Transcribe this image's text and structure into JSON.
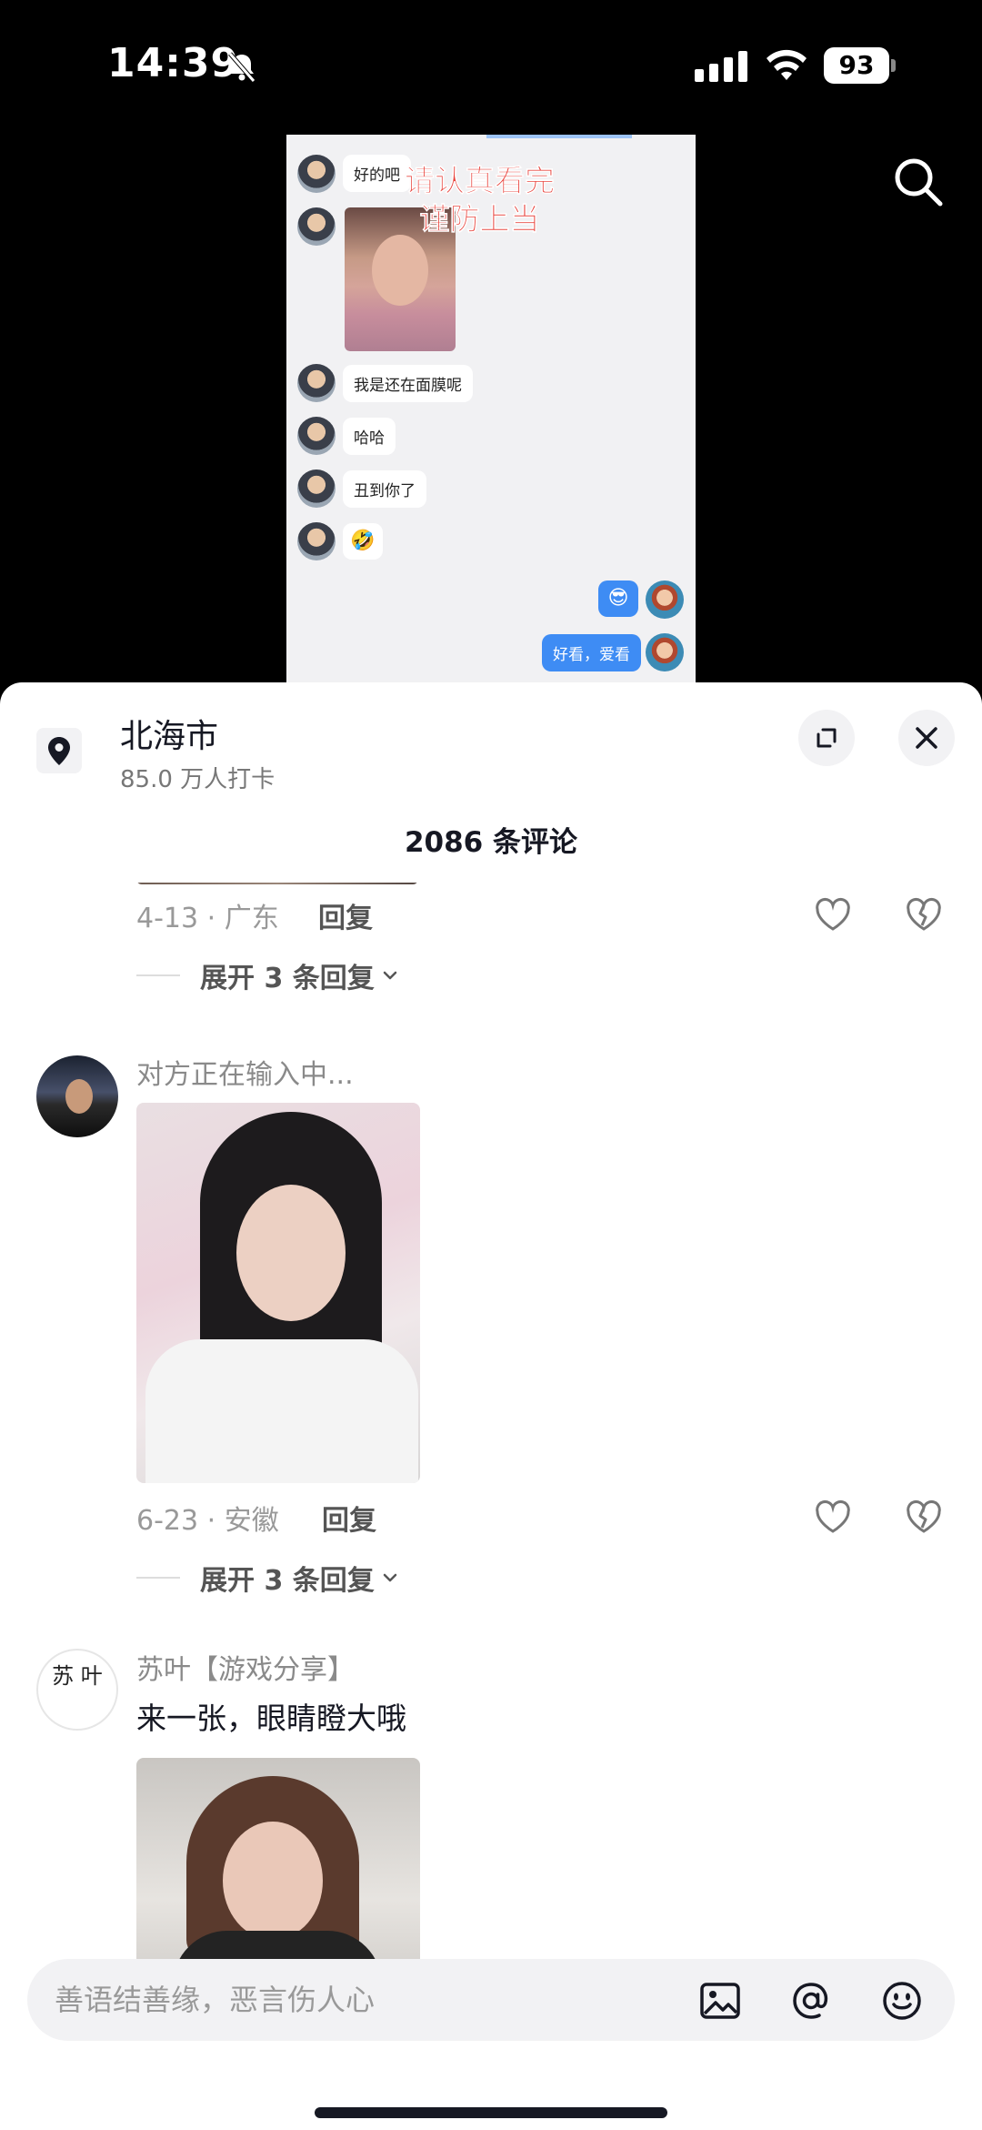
{
  "status_bar": {
    "time": "14:39",
    "battery": "93"
  },
  "video": {
    "overlay_line1": "请认真看完",
    "overlay_line2": "谨防上当",
    "messages": [
      {
        "text": "好的吧"
      },
      {
        "text": "我是还在面膜呢"
      },
      {
        "text": "哈哈"
      },
      {
        "text": "丑到你了"
      },
      {
        "emoji": "🤣"
      },
      {
        "emoji_me": "😎"
      },
      {
        "text_me": "好看，爱看"
      }
    ]
  },
  "sheet": {
    "location_title": "北海市",
    "location_subtitle": "85.0 万人打卡",
    "comment_count": "2086 条评论"
  },
  "comments": [
    {
      "meta": "4-13 · 广东",
      "reply_label": "回复",
      "expand_label": "展开 3 条回复"
    },
    {
      "username": "对方正在输入中...",
      "meta": "6-23 · 安徽",
      "reply_label": "回复",
      "expand_label": "展开 3 条回复"
    },
    {
      "username": "苏叶【游戏分享】",
      "text": "来一张，眼睛瞪大哦",
      "avatar_text": "苏 叶"
    }
  ],
  "input": {
    "placeholder": "善语结善缘，恶言伤人心"
  },
  "colors": {
    "accent_red": "#e8413a",
    "bubble_blue": "#3e8cf4",
    "text_primary": "#161823"
  }
}
